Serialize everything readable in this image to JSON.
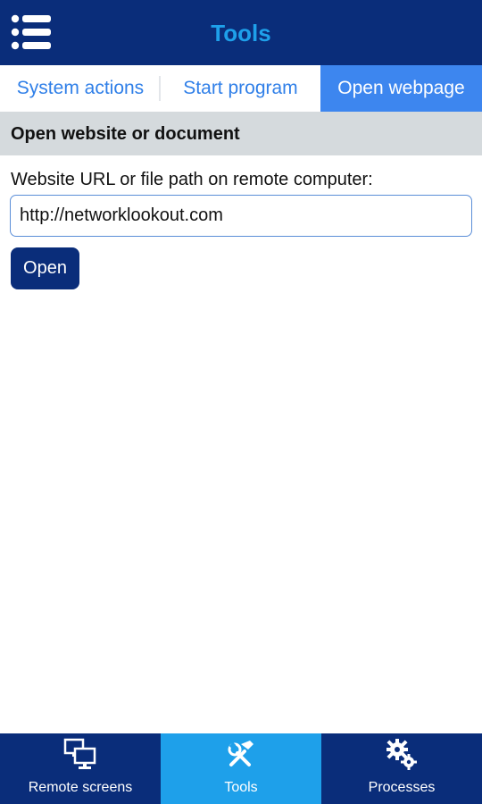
{
  "header": {
    "title": "Tools",
    "menu_icon": "hamburger-list-icon"
  },
  "tabs": [
    {
      "label": "System actions",
      "active": false
    },
    {
      "label": "Start program",
      "active": false
    },
    {
      "label": "Open webpage",
      "active": true
    }
  ],
  "section": {
    "title": "Open website or document"
  },
  "form": {
    "label": "Website URL or file path on remote computer:",
    "url_value": "http://networklookout.com",
    "open_label": "Open"
  },
  "bottom_nav": [
    {
      "label": "Remote screens",
      "icon": "monitors-icon",
      "active": false
    },
    {
      "label": "Tools",
      "icon": "tools-icon",
      "active": true
    },
    {
      "label": "Processes",
      "icon": "gears-icon",
      "active": false
    }
  ],
  "colors": {
    "header_bg": "#0a2d7a",
    "title": "#1ea0ea",
    "tab_text": "#2f7fe8",
    "tab_active_bg": "#3d86ef",
    "section_bg": "#d5dadd",
    "nav_active_bg": "#1ea0ea"
  }
}
